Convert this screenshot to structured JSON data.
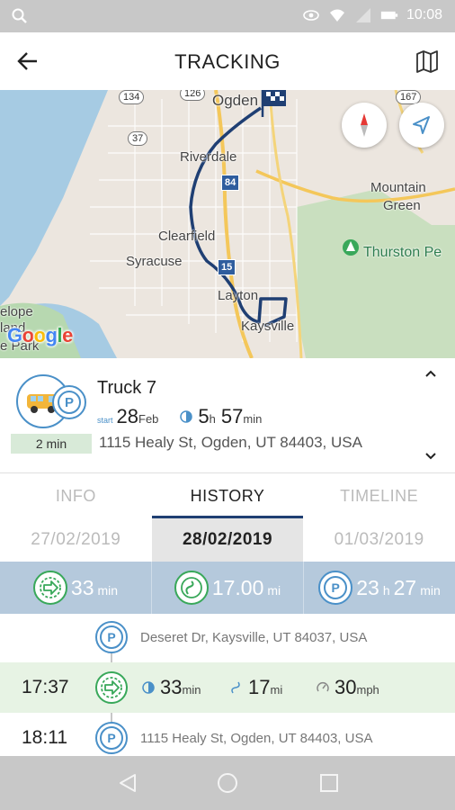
{
  "status_bar": {
    "time": "10:08",
    "icons": [
      "search-icon",
      "eye-icon",
      "wifi-icon",
      "signal-icon",
      "battery-icon"
    ]
  },
  "app_bar": {
    "title": "TRACKING",
    "back_icon": "arrow-left-icon",
    "map_icon": "map-icon"
  },
  "map": {
    "labels": {
      "ogden": "Ogden",
      "riverdale": "Riverdale",
      "mountain": "Mountain",
      "green": "Green",
      "clearfield": "Clearfield",
      "syracuse": "Syracuse",
      "thurston": "Thurston Pe",
      "layton": "Layton",
      "kaysville": "Kaysville",
      "antelope1": "elope",
      "antelope2": "land",
      "antelope3": "e Park"
    },
    "route_shields": {
      "r134": "134",
      "r126": "126",
      "r37": "37",
      "r167": "167",
      "i84": "84",
      "i15": "15"
    },
    "attribution": "Google",
    "colors": {
      "route": "#1f3f73",
      "water": "#a6cbe3",
      "park": "#c9dfbf",
      "highway": "#f4d47a"
    }
  },
  "vehicle": {
    "name": "Truck 7",
    "duration": "2 min",
    "start_label": "start",
    "start_day": "28",
    "start_month": "Feb",
    "elapsed_h_val": "5",
    "elapsed_h_unit": "h",
    "elapsed_m_val": "57",
    "elapsed_m_unit": "min",
    "address": "1115 Healy St, Ogden, UT 84403, USA",
    "status_icon": "parking-icon"
  },
  "tabs": [
    {
      "label": "INFO"
    },
    {
      "label": "HISTORY"
    },
    {
      "label": "TIMELINE"
    }
  ],
  "dates": [
    {
      "label": "27/02/2019"
    },
    {
      "label": "28/02/2019"
    },
    {
      "label": "01/03/2019"
    }
  ],
  "summary": {
    "drive_val": "33",
    "drive_unit": "min",
    "distance_val": "17.00",
    "distance_unit": "mi",
    "park_h_val": "23",
    "park_h_unit": "h",
    "park_m_val": "27",
    "park_m_unit": "min"
  },
  "timeline": {
    "stop1_address": "Deseret Dr, Kaysville, UT 84037, USA",
    "trip_time": "17:37",
    "trip_duration_val": "33",
    "trip_duration_unit": "min",
    "trip_distance_val": "17",
    "trip_distance_unit": "mi",
    "trip_speed_val": "30",
    "trip_speed_unit": "mph",
    "stop2_time": "18:11",
    "stop2_address": "1115 Healy St, Ogden, UT 84403, USA"
  },
  "nav_bar": {
    "icons": [
      "back-triangle-icon",
      "home-circle-icon",
      "recents-square-icon"
    ]
  }
}
